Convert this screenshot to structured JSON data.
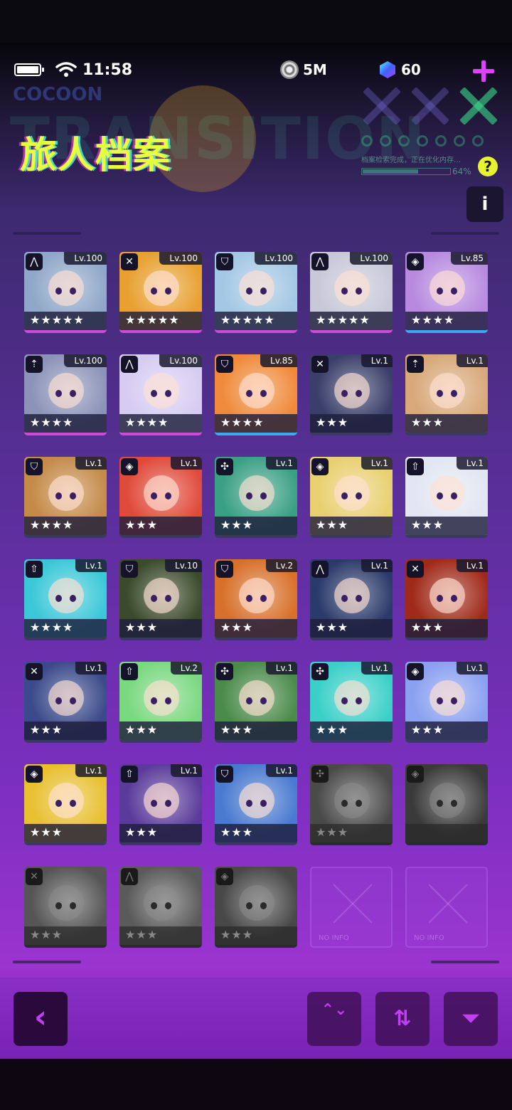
{
  "status_bar": {
    "time": "11:58",
    "coins": "5M",
    "gems": "60"
  },
  "header": {
    "title": "旅人档案",
    "bg_word": "TRANSITION",
    "brand": "COCOON",
    "hud_text": "档案检索完成，正在优化内存…",
    "hud_percent": "64%",
    "hud_progress": 0.64,
    "help_label": "?",
    "info_label": "i"
  },
  "roster": [
    {
      "level": "Lv.100",
      "stars": "★★★★★",
      "class_icon": "tent-icon",
      "color": "#8fa7c9",
      "frame": "#d04ad8",
      "locked": false
    },
    {
      "level": "Lv.100",
      "stars": "★★★★★",
      "class_icon": "crossed-swords-icon",
      "color": "#e8a030",
      "frame": "#d04ad8",
      "locked": false
    },
    {
      "level": "Lv.100",
      "stars": "★★★★★",
      "class_icon": "shield-icon",
      "color": "#a3c7e4",
      "frame": "#d04ad8",
      "locked": false
    },
    {
      "level": "Lv.100",
      "stars": "★★★★★",
      "class_icon": "tent-icon",
      "color": "#c8c8d8",
      "frame": "#d04ad8",
      "locked": false
    },
    {
      "level": "Lv.85",
      "stars": "★★★★",
      "class_icon": "diamond-icon",
      "color": "#b78ae0",
      "frame": "#3aa9f0",
      "locked": false
    },
    {
      "level": "Lv.100",
      "stars": "★★★★",
      "class_icon": "arrow-up-icon",
      "color": "#8c93b8",
      "frame": "#d04ad8",
      "locked": false
    },
    {
      "level": "Lv.100",
      "stars": "★★★★",
      "class_icon": "tent-icon",
      "color": "#d6ccf2",
      "frame": "#d04ad8",
      "locked": false
    },
    {
      "level": "Lv.85",
      "stars": "★★★★",
      "class_icon": "shield-icon",
      "color": "#f08a3a",
      "frame": "#3aa9f0",
      "locked": false
    },
    {
      "level": "Lv.1",
      "stars": "★★★",
      "class_icon": "crossed-swords-icon",
      "color": "#3a3f6a",
      "frame": "#3a3a5e",
      "locked": false
    },
    {
      "level": "Lv.1",
      "stars": "★★★",
      "class_icon": "arrow-up-icon",
      "color": "#d8a87a",
      "frame": "#3a3a5e",
      "locked": false
    },
    {
      "level": "Lv.1",
      "stars": "★★★★",
      "class_icon": "shield-icon",
      "color": "#c48a48",
      "frame": "#3a3a5e",
      "locked": false
    },
    {
      "level": "Lv.1",
      "stars": "★★★",
      "class_icon": "diamond-icon",
      "color": "#e04a3a",
      "frame": "#3a3a5e",
      "locked": false
    },
    {
      "level": "Lv.1",
      "stars": "★★★",
      "class_icon": "heal-icon",
      "color": "#3aa084",
      "frame": "#3a3a5e",
      "locked": false
    },
    {
      "level": "Lv.1",
      "stars": "★★★",
      "class_icon": "diamond-icon",
      "color": "#e8d070",
      "frame": "#3a3a5e",
      "locked": false
    },
    {
      "level": "Lv.1",
      "stars": "★★★",
      "class_icon": "star-up-icon",
      "color": "#e0e6f2",
      "frame": "#3a3a5e",
      "locked": false
    },
    {
      "level": "Lv.1",
      "stars": "★★★★",
      "class_icon": "star-up-icon",
      "color": "#3ac8d8",
      "frame": "#3a3a5e",
      "locked": false
    },
    {
      "level": "Lv.10",
      "stars": "★★★",
      "class_icon": "shield-icon",
      "color": "#3a4a2a",
      "frame": "#3a3a5e",
      "locked": false
    },
    {
      "level": "Lv.2",
      "stars": "★★★",
      "class_icon": "shield-icon",
      "color": "#d8702a",
      "frame": "#3a3a5e",
      "locked": false
    },
    {
      "level": "Lv.1",
      "stars": "★★★",
      "class_icon": "tent-icon",
      "color": "#2a3a6a",
      "frame": "#3a3a5e",
      "locked": false
    },
    {
      "level": "Lv.1",
      "stars": "★★★",
      "class_icon": "crossed-swords-icon",
      "color": "#a02a1a",
      "frame": "#3a3a5e",
      "locked": false
    },
    {
      "level": "Lv.1",
      "stars": "★★★",
      "class_icon": "crossed-swords-icon",
      "color": "#3a4a8a",
      "frame": "#3a3a5e",
      "locked": false
    },
    {
      "level": "Lv.2",
      "stars": "★★★",
      "class_icon": "star-up-icon",
      "color": "#7ad880",
      "frame": "#3a3a5e",
      "locked": false
    },
    {
      "level": "Lv.1",
      "stars": "★★★",
      "class_icon": "heal-icon",
      "color": "#4a8a4a",
      "frame": "#3a3a5e",
      "locked": false
    },
    {
      "level": "Lv.1",
      "stars": "★★★",
      "class_icon": "heal-icon",
      "color": "#3ad0c8",
      "frame": "#3a3a5e",
      "locked": false
    },
    {
      "level": "Lv.1",
      "stars": "★★★",
      "class_icon": "diamond-icon",
      "color": "#8aa0f0",
      "frame": "#3a3a5e",
      "locked": false
    },
    {
      "level": "Lv.1",
      "stars": "★★★",
      "class_icon": "diamond-icon",
      "color": "#e8c030",
      "frame": "#3a3a5e",
      "locked": false
    },
    {
      "level": "Lv.1",
      "stars": "★★★",
      "class_icon": "star-up-icon",
      "color": "#5a3a9a",
      "frame": "#3a3a5e",
      "locked": false
    },
    {
      "level": "Lv.1",
      "stars": "★★★",
      "class_icon": "shield-icon",
      "color": "#4a7ad0",
      "frame": "#3a3a5e",
      "locked": false
    },
    {
      "level": "",
      "stars": "★★★",
      "class_icon": "heal-icon",
      "color": "#4a4a4a",
      "frame": "#2a2a2a",
      "locked": true
    },
    {
      "level": "",
      "stars": "",
      "class_icon": "diamond-icon",
      "color": "#3a3a3a",
      "frame": "#2a2a2a",
      "locked": true
    },
    {
      "level": "",
      "stars": "★★★",
      "class_icon": "crossed-swords-icon",
      "color": "#555555",
      "frame": "#2a2a2a",
      "locked": true
    },
    {
      "level": "",
      "stars": "★★★",
      "class_icon": "tent-icon",
      "color": "#5a5a5a",
      "frame": "#2a2a2a",
      "locked": true
    },
    {
      "level": "",
      "stars": "★★★",
      "class_icon": "diamond-icon",
      "color": "#484848",
      "frame": "#2a2a2a",
      "locked": true
    }
  ],
  "empty_slots": [
    {
      "label": "NO INFO"
    },
    {
      "label": "NO INFO"
    }
  ],
  "bottom": {
    "back_label": "‹",
    "sort_label": "⌃⌄",
    "swap_label": "⇅",
    "filter_label": "⏷"
  },
  "colors": {
    "accent": "#e040ff",
    "title": "#e6ff40",
    "hud": "#50dca0"
  }
}
